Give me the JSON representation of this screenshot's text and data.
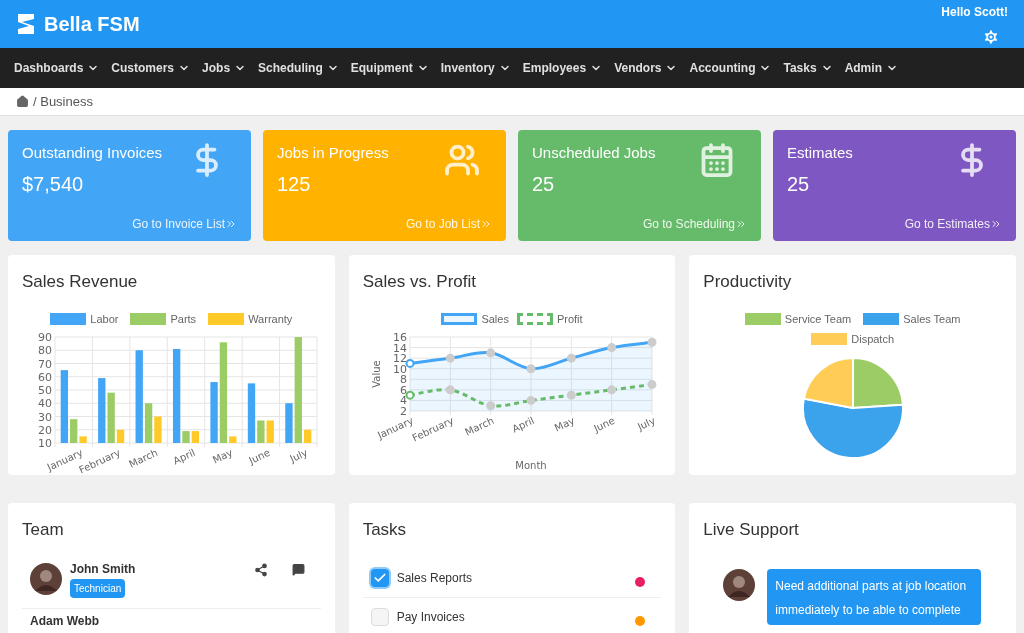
{
  "header": {
    "brand": "Bella FSM",
    "greeting": "Hello Scott!"
  },
  "nav": [
    "Dashboards",
    "Customers",
    "Jobs",
    "Scheduling",
    "Equipment",
    "Inventory",
    "Employees",
    "Vendors",
    "Accounting",
    "Tasks",
    "Admin"
  ],
  "breadcrumb": "/ Business",
  "stats": [
    {
      "title": "Outstanding Invoices",
      "value": "$7,540",
      "link": "Go to Invoice List",
      "color": "#42a5f5"
    },
    {
      "title": "Jobs in Progress",
      "value": "125",
      "link": "Go to Job List",
      "color": "#ffb300"
    },
    {
      "title": "Unscheduled Jobs",
      "value": "25",
      "link": "Go to Scheduling",
      "color": "#66bb6a"
    },
    {
      "title": "Estimates",
      "value": "25",
      "link": "Go to Estimates",
      "color": "#7e57c2"
    }
  ],
  "charts": [
    {
      "title": "Sales Revenue",
      "chart_data": {
        "type": "bar",
        "categories": [
          "January",
          "February",
          "March",
          "April",
          "May",
          "June",
          "July"
        ],
        "series": [
          {
            "name": "Labor",
            "color": "#42a5f5",
            "values": [
              65,
              59,
              80,
              81,
              56,
              55,
              40
            ]
          },
          {
            "name": "Parts",
            "color": "#9ccc65",
            "values": [
              28,
              48,
              40,
              19,
              86,
              27,
              90
            ]
          },
          {
            "name": "Warranty",
            "color": "#ffca28",
            "values": [
              15,
              20,
              30,
              19,
              15,
              27,
              20
            ]
          }
        ],
        "ylim": [
          10,
          90
        ],
        "yticks": [
          10,
          20,
          30,
          40,
          50,
          60,
          70,
          80,
          90
        ],
        "grid": true
      }
    },
    {
      "title": "Sales vs. Profit",
      "chart_data": {
        "type": "line",
        "xlabel": "Month",
        "ylabel": "Value",
        "categories": [
          "January",
          "February",
          "March",
          "April",
          "May",
          "June",
          "July"
        ],
        "series": [
          {
            "name": "Sales",
            "color": "#42a5f5",
            "values": [
              11,
              12,
              13,
              10,
              12,
              14,
              15
            ],
            "marker": "o",
            "line_style": "solid",
            "type": "area"
          },
          {
            "name": "Profit",
            "color": "#66bb6a",
            "values": [
              5,
              6,
              3,
              4,
              5,
              6,
              7
            ],
            "marker": "o",
            "line_style": "dashed",
            "type": "line"
          }
        ],
        "ylim": [
          2,
          16
        ],
        "yticks": [
          2,
          4,
          6,
          8,
          10,
          12,
          14,
          16
        ],
        "grid": true
      }
    },
    {
      "title": "Productivity",
      "chart_data": {
        "type": "pie",
        "categories": [
          "Service Team",
          "Sales Team",
          "Dispatch"
        ],
        "values": [
          24,
          54,
          22
        ],
        "colors": [
          "#9ccc65",
          "#3ba3eb",
          "#ffcd56"
        ]
      }
    }
  ],
  "team": {
    "title": "Team",
    "members": [
      {
        "name": "John Smith",
        "role": "Technician"
      },
      {
        "name": "Adam Webb"
      }
    ]
  },
  "tasks": {
    "title": "Tasks",
    "items": [
      {
        "label": "Sales Reports",
        "checked": true,
        "color": "#e91e63"
      },
      {
        "label": "Pay Invoices",
        "checked": false,
        "color": "#ff9800"
      }
    ]
  },
  "support": {
    "title": "Live Support",
    "message": "Need additional parts at job location immediately to be able to complete"
  }
}
